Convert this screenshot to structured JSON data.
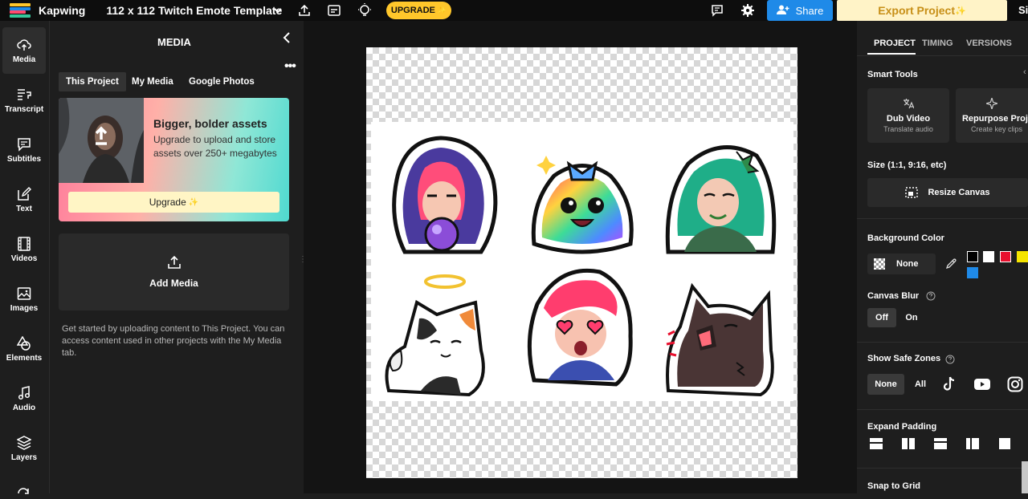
{
  "topbar": {
    "brand": "Kapwing",
    "project_title": "112 x 112 Twitch Emote Template",
    "upgrade_label": "UPGRADE",
    "upgrade_sparkle": "✨",
    "share_label": "Share",
    "export_label": "Export Project",
    "export_sparkle": "✨",
    "sign_in_partial": "Si",
    "logo_colors": [
      "#ffc72b",
      "#1f8ae8",
      "#ff4b6e",
      "#35c79a"
    ]
  },
  "leftnav": {
    "items": [
      {
        "label": "Media",
        "icon": "upload-cloud-icon",
        "active": true
      },
      {
        "label": "Transcript",
        "icon": "transcript-icon"
      },
      {
        "label": "Subtitles",
        "icon": "subtitles-icon"
      },
      {
        "label": "Text",
        "icon": "text-edit-icon"
      },
      {
        "label": "Videos",
        "icon": "film-icon"
      },
      {
        "label": "Images",
        "icon": "image-icon"
      },
      {
        "label": "Elements",
        "icon": "shapes-icon"
      },
      {
        "label": "Audio",
        "icon": "music-note-icon"
      },
      {
        "label": "Layers",
        "icon": "layers-icon"
      }
    ]
  },
  "media": {
    "title": "MEDIA",
    "tabs": [
      "This Project",
      "My Media",
      "Google Photos"
    ],
    "active_tab": "This Project",
    "promo": {
      "title": "Bigger, bolder assets",
      "text": "Upgrade to upload and store assets over 250+ megabytes",
      "button": "Upgrade",
      "button_sparkle": "✨"
    },
    "add_media_label": "Add Media",
    "help_text": "Get started by uploading content to This Project. You can access content used in other projects with the My Media tab."
  },
  "right": {
    "tabs": [
      "PROJECT",
      "TIMING",
      "VERSIONS"
    ],
    "active_tab": "PROJECT",
    "smart_tools_label": "Smart Tools",
    "tools": [
      {
        "name": "Dub Video",
        "sub": "Translate audio",
        "icon": "translate-icon"
      },
      {
        "name": "Repurpose Proje",
        "sub": "Create key clips",
        "icon": "sparkle-icon"
      }
    ],
    "size_label": "Size (1:1, 9:16, etc)",
    "resize_label": "Resize Canvas",
    "bg_color_label": "Background Color",
    "bg_none_label": "None",
    "swatches": [
      "#000000",
      "#ffffff",
      "#e8102e",
      "#f5e400",
      "#1f8ae8"
    ],
    "blur_label": "Canvas Blur",
    "blur_off": "Off",
    "blur_on": "On",
    "safe_zones_label": "Show Safe Zones",
    "safe_none": "None",
    "safe_all": "All",
    "expand_padding_label": "Expand Padding",
    "snap_label": "Snap to Grid"
  }
}
